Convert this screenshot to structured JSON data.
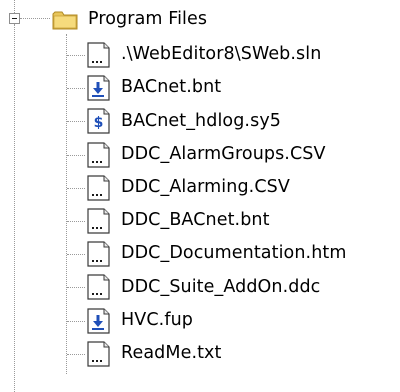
{
  "tree": {
    "folder": {
      "label": "Program Files",
      "expanded": true,
      "icon": "folder-icon",
      "expander_icon": "minus-expander-icon"
    },
    "items": [
      {
        "label": ".\\WebEditor8\\SWeb.sln",
        "icon": "generic-file-icon"
      },
      {
        "label": "BACnet.bnt",
        "icon": "download-file-icon"
      },
      {
        "label": "BACnet_hdlog.sy5",
        "icon": "dollar-file-icon"
      },
      {
        "label": "DDC_AlarmGroups.CSV",
        "icon": "generic-file-icon"
      },
      {
        "label": "DDC_Alarming.CSV",
        "icon": "generic-file-icon"
      },
      {
        "label": "DDC_BACnet.bnt",
        "icon": "generic-file-icon"
      },
      {
        "label": "DDC_Documentation.htm",
        "icon": "generic-file-icon"
      },
      {
        "label": "DDC_Suite_AddOn.ddc",
        "icon": "generic-file-icon"
      },
      {
        "label": "HVC.fup",
        "icon": "download-file-icon"
      },
      {
        "label": "ReadMe.txt",
        "icon": "generic-file-icon"
      }
    ]
  }
}
